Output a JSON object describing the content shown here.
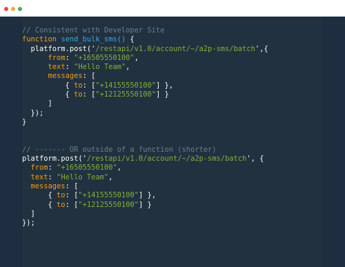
{
  "window": {
    "dots": [
      {
        "name": "close",
        "color": "#e94b35"
      },
      {
        "name": "minimize",
        "color": "#f2a93b"
      },
      {
        "name": "zoom",
        "color": "#4caf50"
      }
    ]
  },
  "code": {
    "lines": [
      [
        {
          "t": "comment",
          "v": "// Consistent with Developer Site"
        }
      ],
      [
        {
          "t": "keyword",
          "v": "function "
        },
        {
          "t": "func",
          "v": "send_bulk_sms()"
        },
        {
          "t": "plain",
          "v": " {"
        }
      ],
      [
        {
          "t": "plain",
          "v": "  platform.post('"
        },
        {
          "t": "path",
          "v": "/restapi/v1.0/account/~/a2p-sms/batch"
        },
        {
          "t": "plain",
          "v": "',{"
        }
      ],
      [
        {
          "t": "plain",
          "v": "      "
        },
        {
          "t": "prop",
          "v": "from"
        },
        {
          "t": "plain",
          "v": ": "
        },
        {
          "t": "string",
          "v": "\"+16505550100\""
        },
        {
          "t": "plain",
          "v": ","
        }
      ],
      [
        {
          "t": "plain",
          "v": "      "
        },
        {
          "t": "prop",
          "v": "text"
        },
        {
          "t": "plain",
          "v": ": "
        },
        {
          "t": "string",
          "v": "\"Hello Team\""
        },
        {
          "t": "plain",
          "v": ","
        }
      ],
      [
        {
          "t": "plain",
          "v": "      "
        },
        {
          "t": "prop",
          "v": "messages"
        },
        {
          "t": "plain",
          "v": ": ["
        }
      ],
      [
        {
          "t": "plain",
          "v": "          { "
        },
        {
          "t": "prop",
          "v": "to"
        },
        {
          "t": "plain",
          "v": ": ["
        },
        {
          "t": "string",
          "v": "\"+14155550100\""
        },
        {
          "t": "plain",
          "v": "] },"
        }
      ],
      [
        {
          "t": "plain",
          "v": "          { "
        },
        {
          "t": "prop",
          "v": "to"
        },
        {
          "t": "plain",
          "v": ": ["
        },
        {
          "t": "string",
          "v": "\"+12125550100\""
        },
        {
          "t": "plain",
          "v": "] }"
        }
      ],
      [
        {
          "t": "plain",
          "v": "      ]"
        }
      ],
      [
        {
          "t": "plain",
          "v": "  });"
        }
      ],
      [
        {
          "t": "plain",
          "v": "}"
        }
      ],
      [
        {
          "t": "plain",
          "v": ""
        }
      ],
      [
        {
          "t": "plain",
          "v": ""
        }
      ],
      [
        {
          "t": "comment",
          "v": "// ------- OR outside of a function (shorter)"
        }
      ],
      [
        {
          "t": "plain",
          "v": "platform.post('"
        },
        {
          "t": "path",
          "v": "/restapi/v1.0/account/~/a2p-sms/batch"
        },
        {
          "t": "plain",
          "v": "', {"
        }
      ],
      [
        {
          "t": "plain",
          "v": "  "
        },
        {
          "t": "prop",
          "v": "from"
        },
        {
          "t": "plain",
          "v": ": "
        },
        {
          "t": "string",
          "v": "\"+16505550100\""
        },
        {
          "t": "plain",
          "v": ","
        }
      ],
      [
        {
          "t": "plain",
          "v": "  "
        },
        {
          "t": "prop",
          "v": "text"
        },
        {
          "t": "plain",
          "v": ": "
        },
        {
          "t": "string",
          "v": "\"Hello Team\""
        },
        {
          "t": "plain",
          "v": ","
        }
      ],
      [
        {
          "t": "plain",
          "v": "  "
        },
        {
          "t": "prop",
          "v": "messages"
        },
        {
          "t": "plain",
          "v": ": ["
        }
      ],
      [
        {
          "t": "plain",
          "v": "      { "
        },
        {
          "t": "prop",
          "v": "to"
        },
        {
          "t": "plain",
          "v": ": ["
        },
        {
          "t": "string",
          "v": "\"+14155550100\""
        },
        {
          "t": "plain",
          "v": "] },"
        }
      ],
      [
        {
          "t": "plain",
          "v": "      { "
        },
        {
          "t": "prop",
          "v": "to"
        },
        {
          "t": "plain",
          "v": ": ["
        },
        {
          "t": "string",
          "v": "\"+12125550100\""
        },
        {
          "t": "plain",
          "v": "] }"
        }
      ],
      [
        {
          "t": "plain",
          "v": "  ]"
        }
      ],
      [
        {
          "t": "plain",
          "v": "});"
        }
      ]
    ]
  }
}
